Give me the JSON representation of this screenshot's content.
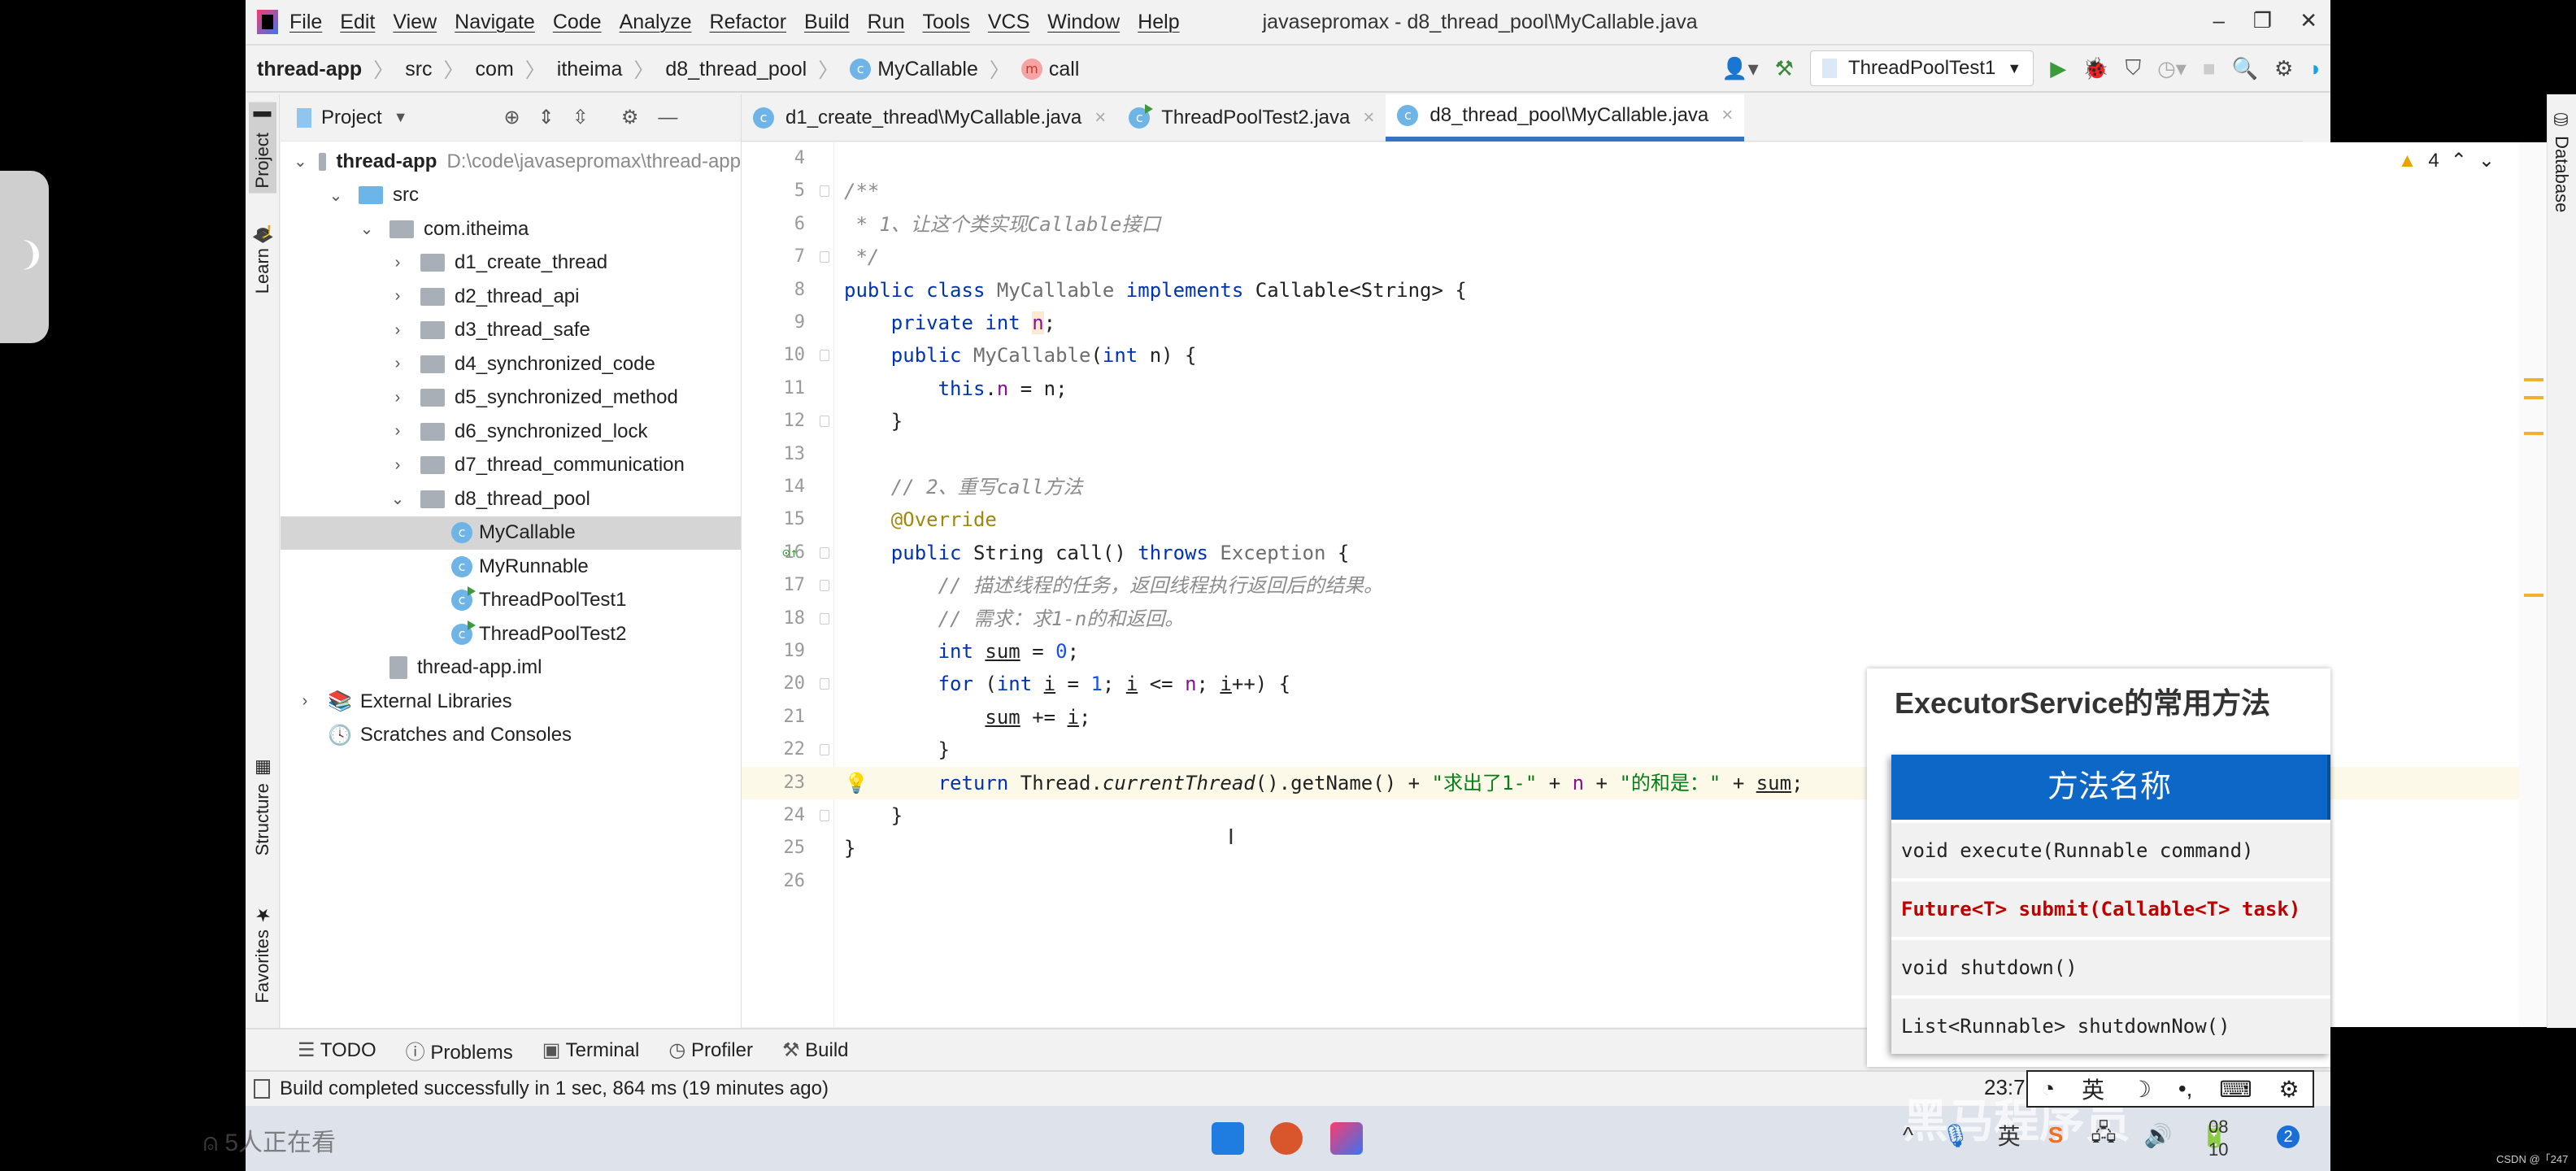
{
  "window": {
    "title": "javasepromax - d8_thread_pool\\MyCallable.java"
  },
  "menu": [
    "File",
    "Edit",
    "View",
    "Navigate",
    "Code",
    "Analyze",
    "Refactor",
    "Build",
    "Run",
    "Tools",
    "VCS",
    "Window",
    "Help"
  ],
  "breadcrumb": [
    "thread-app",
    "src",
    "com",
    "itheima",
    "d8_thread_pool",
    "MyCallable",
    "call"
  ],
  "toolbar": {
    "run_config": "ThreadPoolTest1"
  },
  "left_strip": {
    "project": "Project",
    "learn": "Learn",
    "structure": "Structure",
    "favorites": "Favorites"
  },
  "right_strip": {
    "database": "Database"
  },
  "project_panel": {
    "title": "Project",
    "tree": [
      {
        "label": "thread-app",
        "path": "D:\\code\\javasepromax\\thread-app",
        "level": 0,
        "kind": "module",
        "expanded": true
      },
      {
        "label": "src",
        "level": 1,
        "kind": "src-folder",
        "expanded": true
      },
      {
        "label": "com.itheima",
        "level": 2,
        "kind": "package",
        "expanded": true
      },
      {
        "label": "d1_create_thread",
        "level": 3,
        "kind": "package",
        "expanded": false
      },
      {
        "label": "d2_thread_api",
        "level": 3,
        "kind": "package",
        "expanded": false
      },
      {
        "label": "d3_thread_safe",
        "level": 3,
        "kind": "package",
        "expanded": false
      },
      {
        "label": "d4_synchronized_code",
        "level": 3,
        "kind": "package",
        "expanded": false
      },
      {
        "label": "d5_synchronized_method",
        "level": 3,
        "kind": "package",
        "expanded": false
      },
      {
        "label": "d6_synchronized_lock",
        "level": 3,
        "kind": "package",
        "expanded": false
      },
      {
        "label": "d7_thread_communication",
        "level": 3,
        "kind": "package",
        "expanded": false
      },
      {
        "label": "d8_thread_pool",
        "level": 3,
        "kind": "package",
        "expanded": true
      },
      {
        "label": "MyCallable",
        "level": 4,
        "kind": "class",
        "selected": true
      },
      {
        "label": "MyRunnable",
        "level": 4,
        "kind": "class"
      },
      {
        "label": "ThreadPoolTest1",
        "level": 4,
        "kind": "runnable-class"
      },
      {
        "label": "ThreadPoolTest2",
        "level": 4,
        "kind": "runnable-class"
      },
      {
        "label": "thread-app.iml",
        "level": 2,
        "kind": "iml"
      },
      {
        "label": "External Libraries",
        "level": 0,
        "kind": "libraries",
        "expanded": false
      },
      {
        "label": "Scratches and Consoles",
        "level": 0,
        "kind": "scratches"
      }
    ]
  },
  "tabs": [
    {
      "label": "d1_create_thread\\MyCallable.java",
      "active": false
    },
    {
      "label": "ThreadPoolTest2.java",
      "active": false
    },
    {
      "label": "d8_thread_pool\\MyCallable.java",
      "active": true
    }
  ],
  "editor": {
    "warnings": "4",
    "current_line": 23,
    "lines": [
      {
        "n": "4",
        "t": []
      },
      {
        "n": "5",
        "t": [
          [
            "/**",
            "cm"
          ]
        ]
      },
      {
        "n": "6",
        "t": [
          [
            " * 1、让这个类实现Callable接口",
            "cm"
          ]
        ]
      },
      {
        "n": "7",
        "t": [
          [
            " */",
            "cm"
          ]
        ]
      },
      {
        "n": "8",
        "t": [
          [
            "public class ",
            "kw"
          ],
          [
            "MyCallable ",
            "gr"
          ],
          [
            "implements ",
            "kw"
          ],
          [
            "Callable<String> {",
            ""
          ]
        ]
      },
      {
        "n": "9",
        "t": [
          [
            "    private int ",
            "kw"
          ],
          [
            "n",
            "fld"
          ],
          [
            ";",
            ""
          ]
        ]
      },
      {
        "n": "10",
        "t": [
          [
            "    public ",
            "kw"
          ],
          [
            "MyCallable",
            "gr"
          ],
          [
            "(",
            ""
          ],
          [
            "int ",
            "kw"
          ],
          [
            "n) {",
            ""
          ]
        ]
      },
      {
        "n": "11",
        "t": [
          [
            "        this",
            "kw"
          ],
          [
            ".",
            ""
          ],
          [
            "n",
            "fld"
          ],
          [
            " = n;",
            ""
          ]
        ]
      },
      {
        "n": "12",
        "t": [
          [
            "    }",
            ""
          ]
        ]
      },
      {
        "n": "13",
        "t": []
      },
      {
        "n": "14",
        "t": [
          [
            "    // 2、重写call方法",
            "cm"
          ]
        ]
      },
      {
        "n": "15",
        "t": [
          [
            "    @Override",
            "an"
          ]
        ]
      },
      {
        "n": "16",
        "t": [
          [
            "    public ",
            "kw"
          ],
          [
            "String call() ",
            ""
          ],
          [
            "throws ",
            "kw"
          ],
          [
            "Exception ",
            "gr"
          ],
          [
            "{",
            ""
          ]
        ]
      },
      {
        "n": "17",
        "t": [
          [
            "        // 描述线程的任务，返回线程执行返回后的结果。",
            "cm"
          ]
        ]
      },
      {
        "n": "18",
        "t": [
          [
            "        // 需求：求1-n的和返回。",
            "cm"
          ]
        ]
      },
      {
        "n": "19",
        "t": [
          [
            "        int ",
            "kw"
          ],
          [
            "sum",
            "ul"
          ],
          [
            " = ",
            ""
          ],
          [
            "0",
            "num"
          ],
          [
            ";",
            ""
          ]
        ]
      },
      {
        "n": "20",
        "t": [
          [
            "        for ",
            "kw"
          ],
          [
            "(",
            ""
          ],
          [
            "int ",
            "kw"
          ],
          [
            "i",
            "ul"
          ],
          [
            " = ",
            ""
          ],
          [
            "1",
            "num"
          ],
          [
            "; ",
            ""
          ],
          [
            "i",
            "ul"
          ],
          [
            " <= ",
            ""
          ],
          [
            "n",
            "fld"
          ],
          [
            "; ",
            ""
          ],
          [
            "i",
            "ul"
          ],
          [
            "++) {",
            ""
          ]
        ]
      },
      {
        "n": "21",
        "t": [
          [
            "            ",
            ""
          ],
          [
            "sum",
            "ul"
          ],
          [
            " += ",
            ""
          ],
          [
            "i",
            "ul"
          ],
          [
            ";",
            ""
          ]
        ]
      },
      {
        "n": "22",
        "t": [
          [
            "        }",
            ""
          ]
        ]
      },
      {
        "n": "23",
        "t": [
          [
            "        return ",
            "kw"
          ],
          [
            "Thread.",
            ""
          ],
          [
            "currentThread",
            "it"
          ],
          [
            "().getName() + ",
            ""
          ],
          [
            "\"求出了1-\"",
            "str"
          ],
          [
            " + ",
            ""
          ],
          [
            "n",
            "fld"
          ],
          [
            " + ",
            ""
          ],
          [
            "\"的和是：\"",
            "str"
          ],
          [
            " + ",
            ""
          ],
          [
            "sum",
            "ul"
          ],
          [
            ";",
            ""
          ]
        ]
      },
      {
        "n": "24",
        "t": [
          [
            "    }",
            ""
          ]
        ]
      },
      {
        "n": "25",
        "t": [
          [
            "}",
            ""
          ]
        ]
      },
      {
        "n": "26",
        "t": []
      }
    ]
  },
  "bottom_tools": [
    "TODO",
    "Problems",
    "Terminal",
    "Profiler",
    "Build"
  ],
  "status": {
    "message": "Build completed successfully in 1 sec, 864 ms (19 minutes ago)"
  },
  "overlay_slide": {
    "title": "ExecutorService的常用方法",
    "header": "方法名称",
    "rows": [
      {
        "text": "void execute(Runnable command)",
        "highlight": false
      },
      {
        "text": "Future<T> submit(Callable<T> task)",
        "highlight": true
      },
      {
        "text": "void shutdown()",
        "highlight": false
      },
      {
        "text": "List<Runnable> shutdownNow()",
        "highlight": false
      }
    ]
  },
  "ime": {
    "lang": "英",
    "clock_partial": "23:7"
  },
  "taskbar": {
    "viewers": "5人正在看",
    "tray_lang": "英",
    "date_top": "08",
    "date_bottom": "10",
    "notifications": "2"
  },
  "watermark": "黑马程序员",
  "credit": "CSDN @「247"
}
